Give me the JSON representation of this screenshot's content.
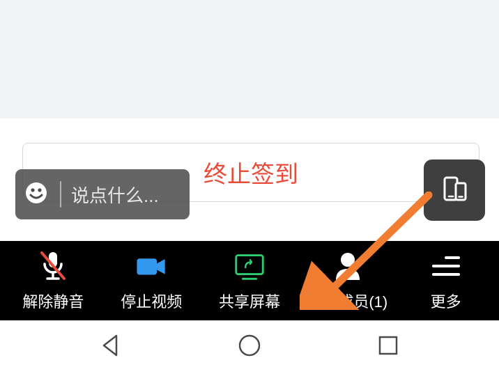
{
  "main": {
    "signin_button_label": "终止签到"
  },
  "chat": {
    "placeholder": "说点什么..."
  },
  "toolbar": {
    "unmute_label": "解除静音",
    "stop_video_label": "停止视频",
    "share_screen_label": "共享屏幕",
    "manage_members_label": "管理成员(1)",
    "more_label": "更多"
  },
  "icons": {
    "smile": "smile-icon",
    "devices": "devices-icon",
    "mic_muted": "mic-muted-icon",
    "video": "video-icon",
    "share": "share-screen-icon",
    "person": "person-icon",
    "more": "more-menu-icon",
    "back": "back-icon",
    "home": "home-icon",
    "recent": "recent-icon"
  },
  "colors": {
    "accent_red": "#e84d3c",
    "accent_green": "#2ecc71",
    "video_blue": "#3498ef",
    "arrow_orange": "#f17d32"
  }
}
